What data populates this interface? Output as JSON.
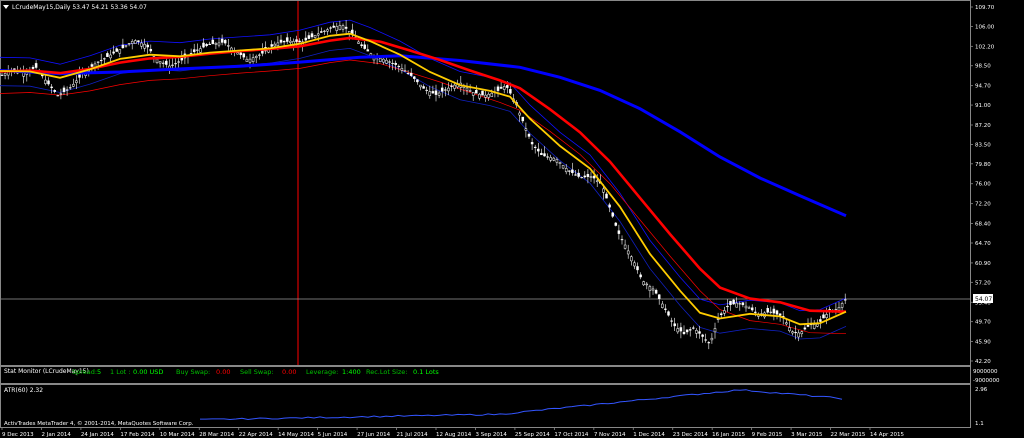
{
  "header": {
    "symbol_line": "LCrudeMay15,Daily  53.47 54.21 53.36 54.07"
  },
  "price_scale": {
    "ticks": [
      "109.70",
      "106.00",
      "102.20",
      "98.50",
      "94.70",
      "91.00",
      "87.20",
      "83.50",
      "79.80",
      "76.00",
      "72.20",
      "68.40",
      "64.70",
      "60.90",
      "57.20",
      "53.40",
      "49.70",
      "45.90",
      "42.20"
    ],
    "current_price": "54.07"
  },
  "date_axis": {
    "ticks": [
      "9 Dec 2013",
      "2 Jan 2014",
      "24 Jan 2014",
      "17 Feb 2014",
      "10 Mar 2014",
      "28 Mar 2014",
      "22 Apr 2014",
      "14 May 2014",
      "5 Jun 2014",
      "27 Jun 2014",
      "21 Jul 2014",
      "12 Aug 2014",
      "3 Sep 2014",
      "25 Sep 2014",
      "17 Oct 2014",
      "7 Nov 2014",
      "1 Dec 2014",
      "23 Dec 2014",
      "16 Jan 2015",
      "9 Feb 2015",
      "3 Mar 2015",
      "22 Mar 2015",
      "14 Apr 2015"
    ]
  },
  "stat_monitor": {
    "title": "Stat Monitor (LCrudeMay15)",
    "spread_label": "Spread:",
    "spread_value": "5",
    "lot_label": "1 Lot :",
    "lot_value": "0.00 USD",
    "buy_swap_label": "Buy Swap:",
    "buy_swap_value": "0.00",
    "sell_swap_label": "Sell Swap:",
    "sell_swap_value": "0.00",
    "leverage_label": "Leverage:",
    "leverage_value": "1:400",
    "rec_lot_label": "Rec.Lot Size:",
    "rec_lot_value": "0.1 Lots",
    "scale_top": "9000000",
    "scale_bottom": "-9000000"
  },
  "atr_panel": {
    "title": "ATR(60) 2.32",
    "scale_top": "2.96",
    "scale_bottom": "1.1"
  },
  "copyright": "ActivTrades MetaTrader 4, © 2001-2014, MetaQuotes Software Corp.",
  "colors": {
    "background": "#000000",
    "candle": "#ffffff",
    "ma_fast": "#ffcc00",
    "ma_mid": "#ff0000",
    "ma_slow": "#0000ff",
    "envelope": "#1010ff",
    "envelope_low": "#ff0000",
    "vline": "#ff0000",
    "atr": "#3355ff"
  },
  "chart_data": {
    "type": "line",
    "ylim": [
      42.2,
      109.7
    ],
    "price_path": [
      [
        0,
        96.5
      ],
      [
        12,
        97.8
      ],
      [
        24,
        97.2
      ],
      [
        36,
        98.2
      ],
      [
        46,
        95.6
      ],
      [
        58,
        92.8
      ],
      [
        70,
        94.3
      ],
      [
        82,
        96.8
      ],
      [
        96,
        99
      ],
      [
        110,
        100.5
      ],
      [
        122,
        101.8
      ],
      [
        134,
        103.4
      ],
      [
        146,
        102.5
      ],
      [
        158,
        99.5
      ],
      [
        170,
        98.4
      ],
      [
        182,
        99.6
      ],
      [
        196,
        101.4
      ],
      [
        210,
        102.6
      ],
      [
        224,
        103
      ],
      [
        236,
        101.2
      ],
      [
        248,
        99.6
      ],
      [
        262,
        100.8
      ],
      [
        276,
        102.8
      ],
      [
        290,
        103.2
      ],
      [
        302,
        103
      ],
      [
        316,
        104.4
      ],
      [
        330,
        105.6
      ],
      [
        342,
        106.3
      ],
      [
        352,
        104.6
      ],
      [
        362,
        102.2
      ],
      [
        374,
        100.3
      ],
      [
        386,
        99.6
      ],
      [
        400,
        98.3
      ],
      [
        412,
        96.5
      ],
      [
        424,
        94.1
      ],
      [
        436,
        93
      ],
      [
        448,
        94.2
      ],
      [
        460,
        95.3
      ],
      [
        472,
        93.5
      ],
      [
        484,
        92.8
      ],
      [
        496,
        93.5
      ],
      [
        506,
        94.8
      ],
      [
        516,
        91.3
      ],
      [
        524,
        87.4
      ],
      [
        532,
        83.6
      ],
      [
        542,
        81.4
      ],
      [
        556,
        80.8
      ],
      [
        568,
        78.6
      ],
      [
        580,
        77.2
      ],
      [
        592,
        77.4
      ],
      [
        602,
        75.8
      ],
      [
        610,
        71.3
      ],
      [
        618,
        66.8
      ],
      [
        626,
        64
      ],
      [
        634,
        61.1
      ],
      [
        642,
        57.6
      ],
      [
        654,
        55.8
      ],
      [
        664,
        52.5
      ],
      [
        674,
        49
      ],
      [
        684,
        47.4
      ],
      [
        694,
        48.5
      ],
      [
        702,
        47
      ],
      [
        710,
        45.4
      ],
      [
        718,
        50.2
      ],
      [
        728,
        52.8
      ],
      [
        738,
        53.3
      ],
      [
        748,
        52.5
      ],
      [
        758,
        51.1
      ],
      [
        770,
        51.6
      ],
      [
        782,
        50.8
      ],
      [
        792,
        47.8
      ],
      [
        800,
        47.5
      ],
      [
        810,
        49.1
      ],
      [
        818,
        49.2
      ],
      [
        828,
        51.4
      ],
      [
        838,
        52.2
      ],
      [
        846,
        54.1
      ]
    ],
    "ma_fast": [
      [
        0,
        97.5
      ],
      [
        30,
        97.4
      ],
      [
        60,
        96.2
      ],
      [
        90,
        97.8
      ],
      [
        120,
        99.8
      ],
      [
        150,
        100.6
      ],
      [
        180,
        100.3
      ],
      [
        210,
        101
      ],
      [
        240,
        101.4
      ],
      [
        270,
        101.8
      ],
      [
        300,
        102.7
      ],
      [
        330,
        104.2
      ],
      [
        350,
        104.6
      ],
      [
        370,
        103.2
      ],
      [
        400,
        100.6
      ],
      [
        430,
        97.3
      ],
      [
        460,
        94.8
      ],
      [
        490,
        93.7
      ],
      [
        510,
        92.6
      ],
      [
        530,
        88.4
      ],
      [
        560,
        83.2
      ],
      [
        590,
        78.9
      ],
      [
        620,
        71.6
      ],
      [
        650,
        62.6
      ],
      [
        680,
        55.6
      ],
      [
        700,
        51.4
      ],
      [
        720,
        50.3
      ],
      [
        750,
        51.2
      ],
      [
        780,
        50.7
      ],
      [
        800,
        49.2
      ],
      [
        820,
        49.4
      ],
      [
        846,
        51.6
      ]
    ],
    "ma_mid": [
      [
        0,
        97.4
      ],
      [
        30,
        97.6
      ],
      [
        60,
        97.1
      ],
      [
        90,
        97.9
      ],
      [
        120,
        99.1
      ],
      [
        150,
        99.9
      ],
      [
        180,
        100.2
      ],
      [
        210,
        100.8
      ],
      [
        240,
        101.3
      ],
      [
        270,
        101.7
      ],
      [
        300,
        102.2
      ],
      [
        330,
        103.3
      ],
      [
        350,
        103.8
      ],
      [
        380,
        103.1
      ],
      [
        410,
        101.4
      ],
      [
        440,
        99.6
      ],
      [
        470,
        97.6
      ],
      [
        500,
        95.7
      ],
      [
        520,
        94.2
      ],
      [
        550,
        90.2
      ],
      [
        580,
        85.8
      ],
      [
        610,
        80.2
      ],
      [
        640,
        73.3
      ],
      [
        670,
        66.4
      ],
      [
        700,
        59.8
      ],
      [
        720,
        56.2
      ],
      [
        750,
        54.1
      ],
      [
        780,
        53.4
      ],
      [
        810,
        51.8
      ],
      [
        846,
        51.6
      ]
    ],
    "ma_slow": [
      [
        0,
        97.6
      ],
      [
        60,
        97
      ],
      [
        120,
        97.3
      ],
      [
        180,
        97.9
      ],
      [
        240,
        98.4
      ],
      [
        300,
        99.2
      ],
      [
        360,
        100.1
      ],
      [
        400,
        100.4
      ],
      [
        460,
        99.5
      ],
      [
        520,
        98.2
      ],
      [
        560,
        96.3
      ],
      [
        600,
        93.8
      ],
      [
        640,
        90.3
      ],
      [
        680,
        85.9
      ],
      [
        720,
        81.1
      ],
      [
        760,
        77.1
      ],
      [
        800,
        73.7
      ],
      [
        846,
        69.9
      ]
    ]
  }
}
